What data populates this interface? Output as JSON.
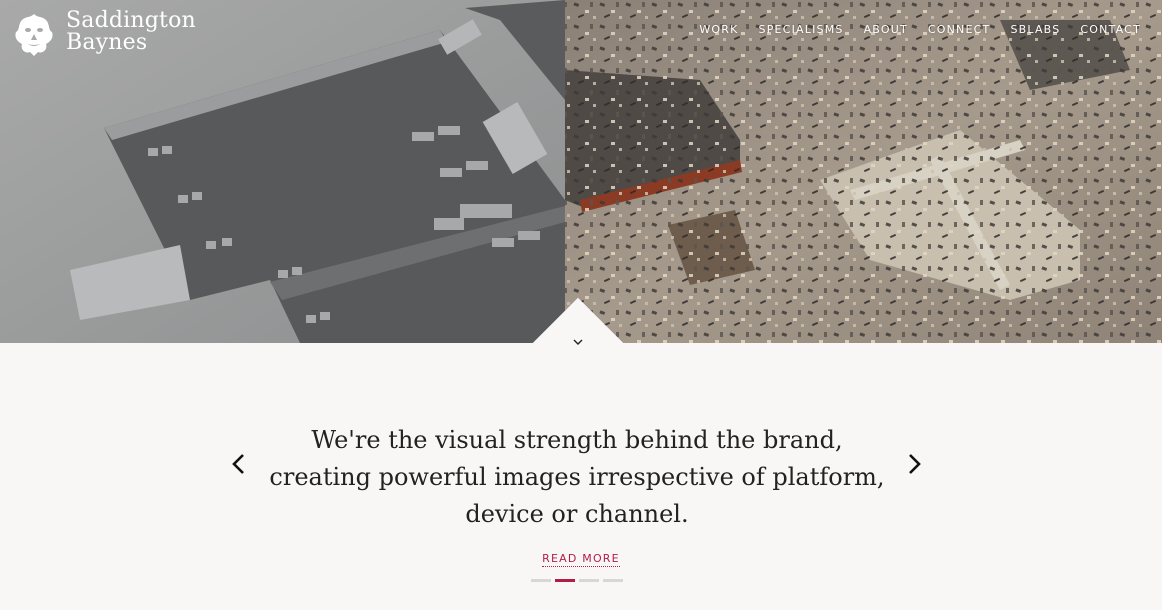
{
  "brand": {
    "line1": "Saddington",
    "line2": "Baynes",
    "logo_icon": "lion-crest-icon"
  },
  "nav": {
    "items": [
      {
        "label": "WORK"
      },
      {
        "label": "SPECIALISMS"
      },
      {
        "label": "ABOUT"
      },
      {
        "label": "CONNECT"
      },
      {
        "label": "SBLABS"
      },
      {
        "label": "CONTACT"
      }
    ]
  },
  "hero": {
    "scroll_icon": "chevron-down-icon"
  },
  "carousel": {
    "quote": "We're the visual strength behind the brand, creating powerful images irrespective of platform, device or channel.",
    "read_more": "READ MORE",
    "prev_icon": "chevron-left-icon",
    "next_icon": "chevron-right-icon",
    "slide_count": 4,
    "active_slide": 2
  },
  "colors": {
    "accent": "#b21d48",
    "background": "#f8f7f5",
    "text": "#222222"
  }
}
